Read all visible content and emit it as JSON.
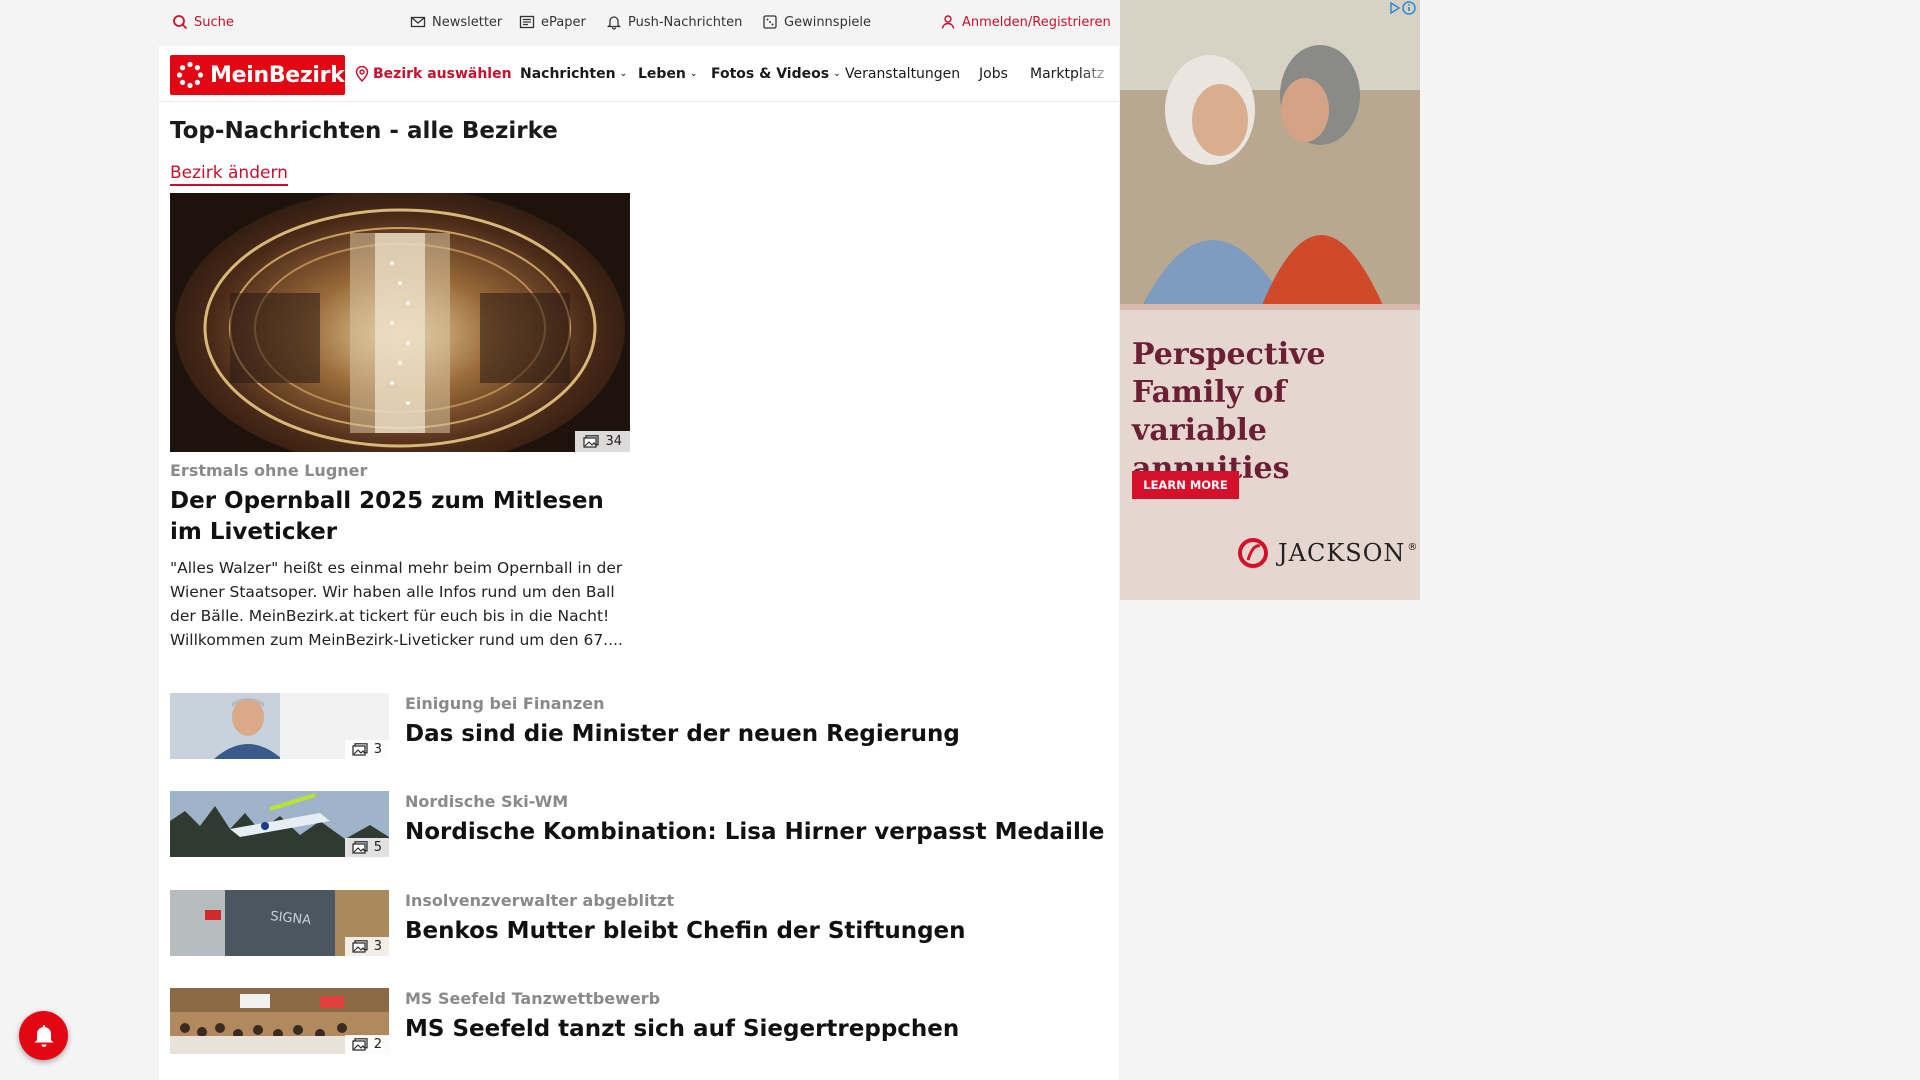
{
  "utility_bar": {
    "search": "Suche",
    "newsletter": "Newsletter",
    "epaper": "ePaper",
    "push": "Push-Nachrichten",
    "contests": "Gewinnspiele",
    "login": "Anmelden/Registrieren"
  },
  "nav": {
    "logo": "MeinBezirk",
    "select_district": "Bezirk auswählen",
    "items": [
      "Nachrichten",
      "Leben",
      "Fotos & Videos",
      "Veranstaltungen",
      "Jobs",
      "Marktplatz"
    ]
  },
  "main": {
    "section_title": "Top-Nachrichten - alle Bezirke",
    "change_district": "Bezirk ändern",
    "hero": {
      "image_count": "34",
      "kicker": "Erstmals ohne Lugner",
      "headline": "Der Opernball 2025 zum Mitlesen im Liveticker",
      "teaser": "\"Alles Walzer\" heißt es einmal mehr beim Opernball in der Wiener Staatsoper. Wir haben alle Infos rund um den Ball der Bälle. MeinBezirk.at tickert für euch bis in die Nacht! Willkommen zum MeinBezirk-Liveticker rund um den 67...."
    },
    "articles": [
      {
        "kicker": "Einigung bei Finanzen",
        "headline": "Das sind die Minister der neuen Regierung",
        "image_count": "3"
      },
      {
        "kicker": "Nordische Ski-WM",
        "headline": "Nordische Kombination: Lisa Hirner verpasst Medaille",
        "image_count": "5"
      },
      {
        "kicker": "Insolvenzverwalter abgeblitzt",
        "headline": "Benkos Mutter bleibt Chefin der Stiftungen",
        "image_count": "3"
      },
      {
        "kicker": "MS Seefeld Tanzwettbewerb",
        "headline": "MS Seefeld tanzt sich auf Siegertreppchen",
        "image_count": "2"
      }
    ]
  },
  "ad": {
    "headline": "Perspective Family of variable annuities",
    "cta": "LEARN MORE",
    "brand": "JACKSON",
    "brand_mark": "®",
    "colors": {
      "background": "#e5d6d0",
      "headline": "#6b1f35",
      "cta": "#d4102b"
    }
  },
  "colors": {
    "brand": "#e30613",
    "accent": "#c8102e",
    "kicker": "#8a8a8a"
  },
  "icons": [
    "search-icon",
    "envelope-icon",
    "newspaper-icon",
    "bell-icon",
    "gift-icon",
    "user-icon",
    "location-pin-icon",
    "chevron-down-icon",
    "image-gallery-icon",
    "ad-choices-icon"
  ]
}
